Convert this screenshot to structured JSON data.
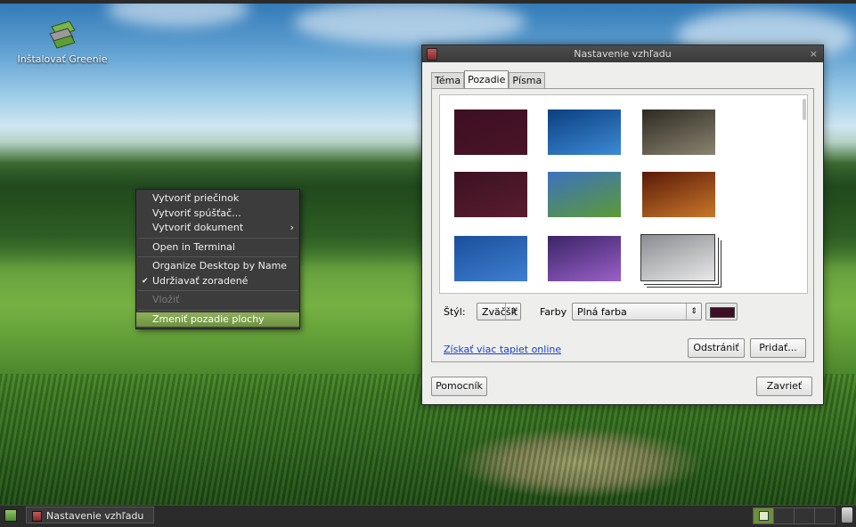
{
  "desktop": {
    "icon_label": "Inštalovať Greenie"
  },
  "context_menu": {
    "items": [
      {
        "label": "Vytvoriť priečinok"
      },
      {
        "label": "Vytvoriť spúšťač..."
      },
      {
        "label": "Vytvoriť dokument",
        "submenu_arrow": "›"
      },
      {
        "label": "Open in Terminal"
      },
      {
        "label": "Organize Desktop by Name"
      },
      {
        "label": "Udržiavať zoradené",
        "checked": true,
        "check_glyph": "✔"
      },
      {
        "label": "Vložiť",
        "disabled": true
      },
      {
        "label": "Zmeniť pozadie plochy",
        "highlighted": true
      }
    ]
  },
  "dialog": {
    "title": "Nastavenie vzhľadu",
    "close_glyph": "×",
    "tabs": [
      {
        "label": "Téma"
      },
      {
        "label": "Pozadie",
        "active": true
      },
      {
        "label": "Písma"
      }
    ],
    "wallpapers": [
      {
        "name": "dark-purple",
        "colors": [
          "#3d0f22",
          "#4a1428"
        ]
      },
      {
        "name": "blue-light-streak",
        "colors": [
          "#0b3f80",
          "#3d8ad6"
        ]
      },
      {
        "name": "sepia-landscape-car",
        "colors": [
          "#2d2a22",
          "#8a8470"
        ]
      },
      {
        "name": "dark-purple-lips",
        "colors": [
          "#3b1222",
          "#5a1d30"
        ]
      },
      {
        "name": "tree-field-sunset",
        "colors": [
          "#3c72c0",
          "#5c9a35"
        ]
      },
      {
        "name": "red-berries",
        "colors": [
          "#5a1a08",
          "#c9782a"
        ]
      },
      {
        "name": "blue-branch-silhouette",
        "colors": [
          "#1b4f9c",
          "#3f7fd0"
        ]
      },
      {
        "name": "purple-lightning",
        "colors": [
          "#3a2466",
          "#9a60c8"
        ]
      },
      {
        "name": "clouds-stack",
        "colors": [
          "#8a8c90",
          "#e8e8e8"
        ]
      }
    ],
    "style_label": "Štýl:",
    "style_value": "Zväčšiť",
    "colors_label": "Farby",
    "colors_value": "Plná farba",
    "selected_color": "#3d0f22",
    "spin_glyph": "⇕",
    "more_link": "Získať viac tapiet online",
    "remove_button": "Odstrániť",
    "add_button": "Pridať...",
    "help_button": "Pomocník",
    "close_button": "Zavrieť"
  },
  "taskbar": {
    "task_label": "Nastavenie vzhľadu"
  }
}
